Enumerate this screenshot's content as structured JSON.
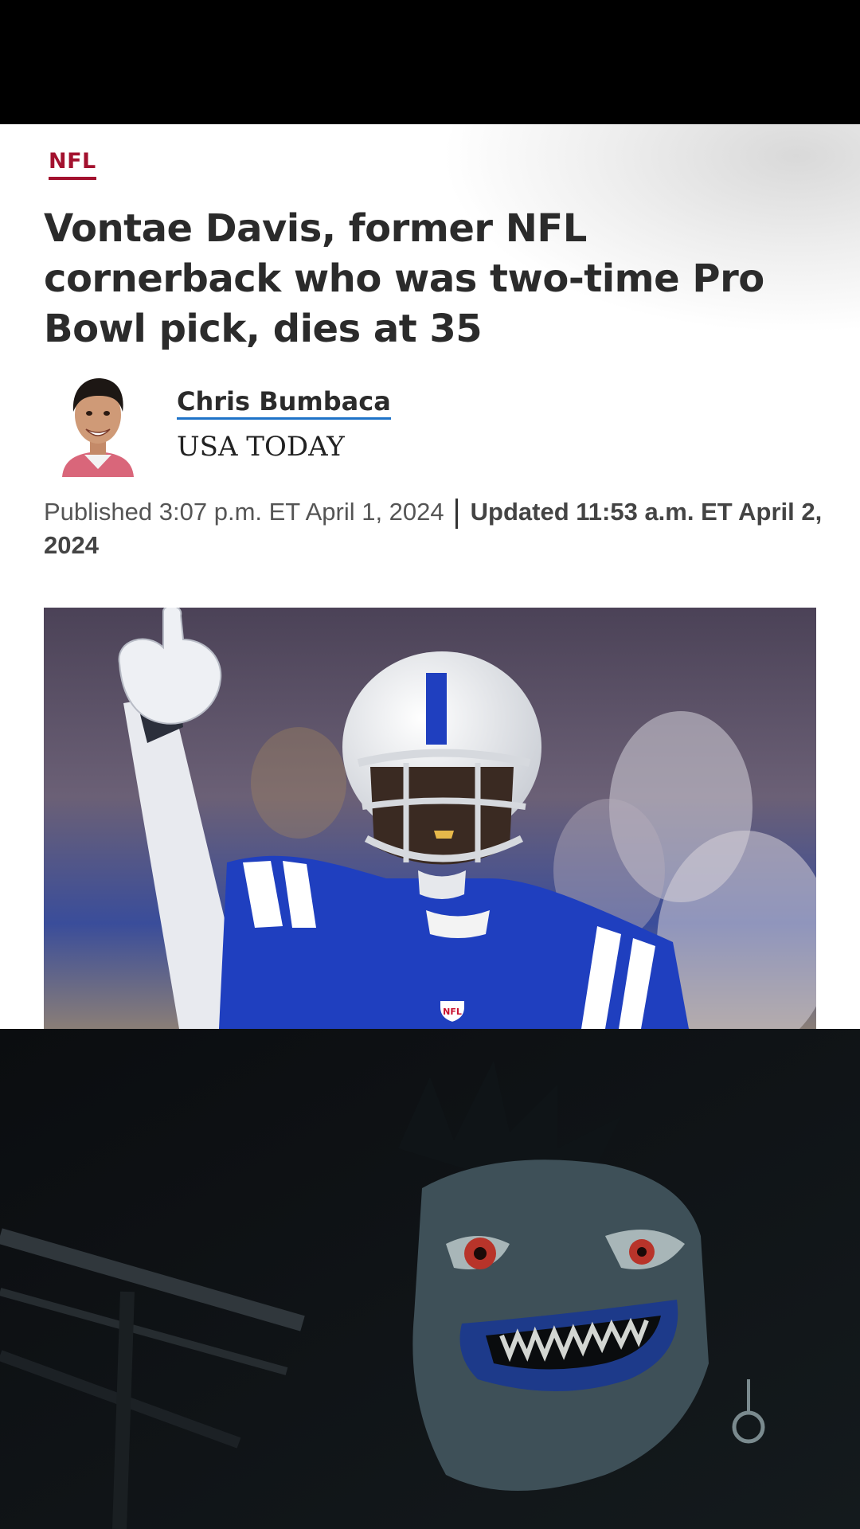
{
  "article": {
    "section": "NFL",
    "headline": "Vontae Davis, former NFL cornerback who was two-time Pro Bowl pick, dies at 35",
    "author": {
      "name": "Chris Bumbaca",
      "outlet": "USA TODAY"
    },
    "published": "Published 3:07 p.m. ET April 1, 2024",
    "updated": "Updated 11:53 a.m. ET April 2, 2024"
  },
  "photo": {
    "jersey_badge": "NFL"
  },
  "colors": {
    "section_accent": "#a3112e",
    "author_underline": "#1e73c8",
    "jersey_blue": "#1f3fbf"
  },
  "icons": [
    "author-avatar",
    "nfl-shield-icon"
  ]
}
